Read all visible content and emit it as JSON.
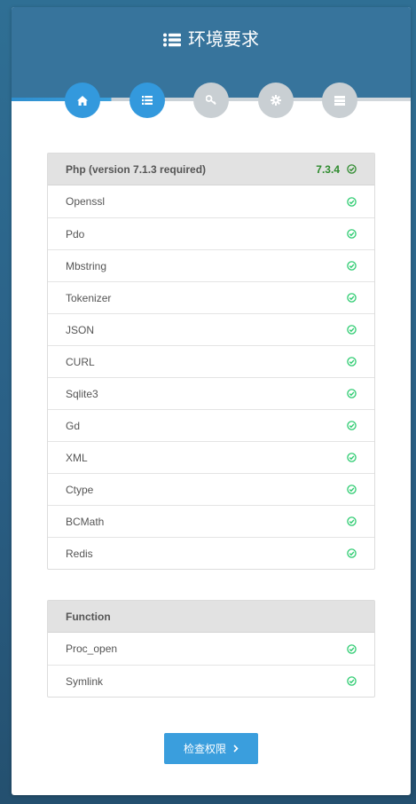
{
  "header": {
    "title": "环境要求",
    "title_icon": "list-icon"
  },
  "steps": [
    {
      "icon": "home-icon",
      "state": "completed"
    },
    {
      "icon": "list-icon",
      "state": "current"
    },
    {
      "icon": "key-icon",
      "state": "pending"
    },
    {
      "icon": "gear-icon",
      "state": "pending"
    },
    {
      "icon": "server-icon",
      "state": "pending"
    }
  ],
  "requirements": {
    "header_label": "Php (version 7.1.3 required)",
    "version": "7.3.4",
    "items": [
      "Openssl",
      "Pdo",
      "Mbstring",
      "Tokenizer",
      "JSON",
      "CURL",
      "Sqlite3",
      "Gd",
      "XML",
      "Ctype",
      "BCMath",
      "Redis"
    ]
  },
  "functions": {
    "header_label": "Function",
    "items": [
      "Proc_open",
      "Symlink"
    ]
  },
  "next_button": {
    "label": "检查权限",
    "icon": "chevron-right-icon"
  },
  "colors": {
    "header_bg": "#37749c",
    "accent": "#3399dd",
    "inactive_step": "#c9cfd3",
    "check_green": "#2ecc71",
    "version_green": "#2e8b2e"
  }
}
